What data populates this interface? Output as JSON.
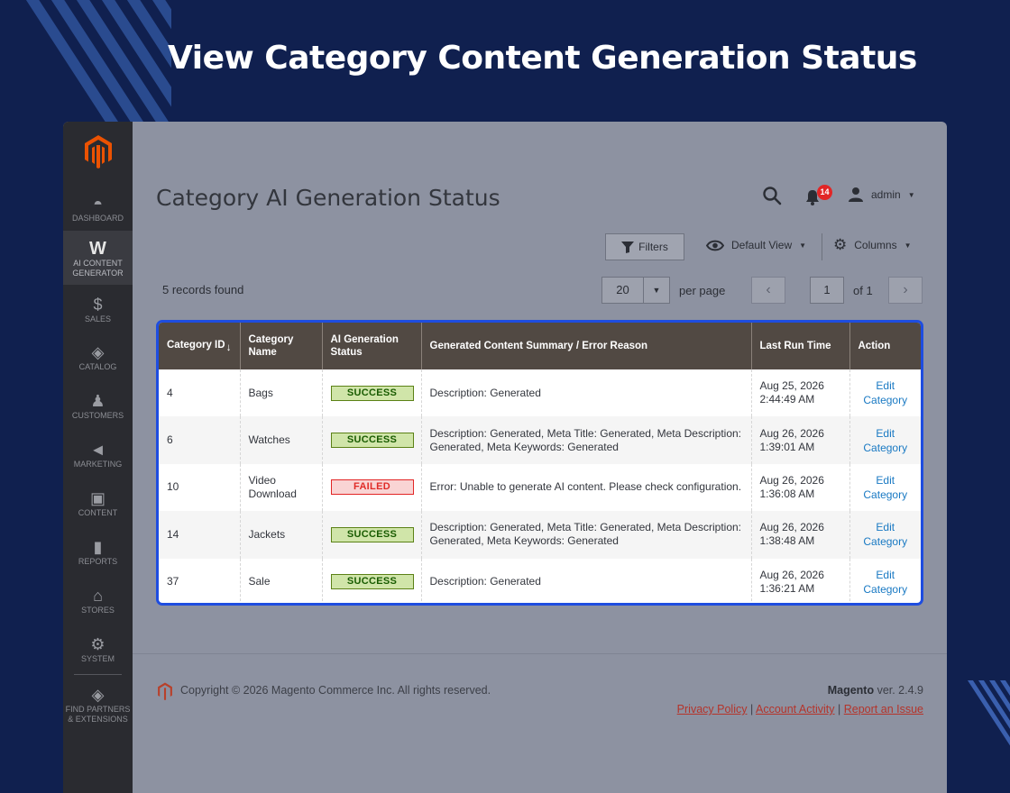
{
  "headline": "View Category Content Generation Status",
  "sidebar": {
    "items": [
      {
        "id": "dashboard",
        "label": "DASHBOARD",
        "icon": "speedometer-icon",
        "glyph": "◓"
      },
      {
        "id": "ai-content-generator",
        "label": "AI CONTENT GENERATOR",
        "icon": "ai-w-icon",
        "glyph": "W",
        "active": true
      },
      {
        "id": "sales",
        "label": "SALES",
        "icon": "dollar-icon",
        "glyph": "$"
      },
      {
        "id": "catalog",
        "label": "CATALOG",
        "icon": "box-icon",
        "glyph": "◈"
      },
      {
        "id": "customers",
        "label": "CUSTOMERS",
        "icon": "person-icon",
        "glyph": "♟"
      },
      {
        "id": "marketing",
        "label": "MARKETING",
        "icon": "megaphone-icon",
        "glyph": "◄"
      },
      {
        "id": "content",
        "label": "CONTENT",
        "icon": "layout-icon",
        "glyph": "▣"
      },
      {
        "id": "reports",
        "label": "REPORTS",
        "icon": "bar-chart-icon",
        "glyph": "▮"
      },
      {
        "id": "stores",
        "label": "STORES",
        "icon": "storefront-icon",
        "glyph": "⌂"
      },
      {
        "id": "system",
        "label": "SYSTEM",
        "icon": "gear-icon",
        "glyph": "⚙"
      },
      {
        "id": "find-partners",
        "label": "FIND PARTNERS & EXTENSIONS",
        "icon": "cube-icon",
        "glyph": "◈"
      }
    ]
  },
  "page": {
    "title": "Category AI Generation Status",
    "notification_count": "14",
    "user": "admin"
  },
  "toolbar": {
    "filters_label": "Filters",
    "view_label": "Default View",
    "columns_label": "Columns",
    "records_found": "5 records found",
    "per_page_value": "20",
    "per_page_label": "per page",
    "current_page": "1",
    "of_pages": "of 1"
  },
  "grid": {
    "columns": [
      "Category ID",
      "Category Name",
      "AI Generation Status",
      "Generated Content Summary / Error Reason",
      "Last Run Time",
      "Action"
    ],
    "rows": [
      {
        "id": "4",
        "name": "Bags",
        "status": "SUCCESS",
        "summary": "Description: Generated",
        "time": "Aug 25, 2026 2:44:49 AM",
        "action": "Edit Category"
      },
      {
        "id": "6",
        "name": "Watches",
        "status": "SUCCESS",
        "summary": "Description: Generated, Meta Title: Generated, Meta Description: Generated, Meta Keywords: Generated",
        "time": "Aug 26, 2026 1:39:01 AM",
        "action": "Edit Category"
      },
      {
        "id": "10",
        "name": "Video Download",
        "status": "FAILED",
        "summary": "Error: Unable to generate AI content. Please check configuration.",
        "time": "Aug 26, 2026 1:36:08 AM",
        "action": "Edit Category"
      },
      {
        "id": "14",
        "name": "Jackets",
        "status": "SUCCESS",
        "summary": "Description: Generated, Meta Title: Generated, Meta Description: Generated, Meta Keywords: Generated",
        "time": "Aug 26, 2026 1:38:48 AM",
        "action": "Edit Category"
      },
      {
        "id": "37",
        "name": "Sale",
        "status": "SUCCESS",
        "summary": "Description: Generated",
        "time": "Aug 26, 2026 1:36:21 AM",
        "action": "Edit Category"
      }
    ]
  },
  "footer": {
    "copyright": "Copyright © 2026 Magento Commerce Inc. All rights reserved.",
    "brand": "Magento",
    "version": " ver. 2.4.9",
    "links": [
      "Privacy Policy",
      "Account Activity",
      "Report an Issue"
    ]
  },
  "colors": {
    "background": "#10204f",
    "header_row": "#514943",
    "success": "#185b00",
    "failed": "#e02b27",
    "link": "#1979c3",
    "highlight_border": "#1e4de0"
  }
}
